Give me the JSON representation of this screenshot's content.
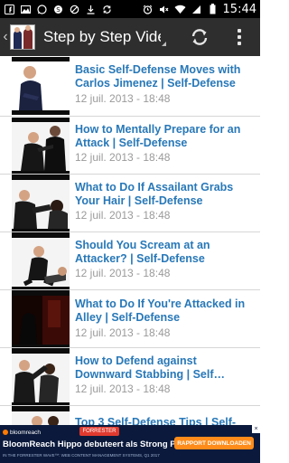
{
  "status_bar": {
    "time": "15:44",
    "left_icons": [
      "facebook-notification-icon",
      "image-notification-icon",
      "whatsapp-notification-icon",
      "skype-notification-icon",
      "block-icon",
      "download-icon",
      "sync-icon"
    ],
    "right_icons": [
      "alarm-icon",
      "mute-icon",
      "wifi-icon",
      "signal-icon",
      "battery-icon"
    ]
  },
  "action_bar": {
    "title": "Step by Step Video",
    "background": "#2e2e2e"
  },
  "videos": [
    {
      "title": "Basic Self-Defense Moves with Carlos Jimenez | Self-Defense",
      "date": "12 juil. 2013 - 18:48"
    },
    {
      "title": "How to Mentally Prepare for an Attack | Self-Defense",
      "date": "12 juil. 2013 - 18:48"
    },
    {
      "title": "What to Do If Assailant Grabs Your Hair | Self-Defense",
      "date": "12 juil. 2013 - 18:48"
    },
    {
      "title": "Should You Scream at an Attacker? | Self-Defense",
      "date": "12 juil. 2013 - 18:48"
    },
    {
      "title": "What to Do If You're Attacked in Alley | Self-Defense",
      "date": "12 juil. 2013 - 18:48"
    },
    {
      "title": "How to Defend against Downward Stabbing | Self…",
      "date": "12 juil. 2013 - 18:48"
    },
    {
      "title": "Top 3 Self-Defense Tips | Self-",
      "date": ""
    }
  ],
  "ad": {
    "brand": "bloomreach",
    "badge": "FORRESTER",
    "headline": "BloomReach Hippo debuteert als Strong Performer",
    "subtext": "IN THE FORRESTER WAVE™: WEB CONTENT MANAGEMENT SYSTEMS, Q1 2017",
    "cta": "RAPPORT DOWNLOADEN",
    "close": "×"
  },
  "colors": {
    "title_link": "#2878b8",
    "date_text": "#9a9a9a",
    "ad_background": "#0b1a3c",
    "ad_cta": "#ff8c1a"
  }
}
